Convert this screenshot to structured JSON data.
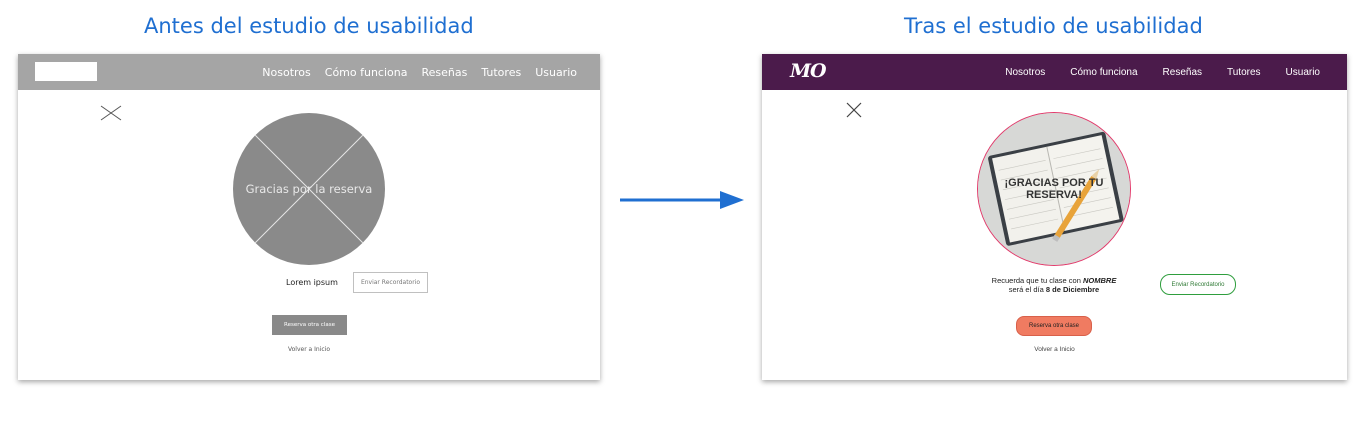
{
  "before": {
    "heading": "Antes del estudio de usabilidad",
    "nav": {
      "items": [
        "Nosotros",
        "Cómo funciona",
        "Reseñas",
        "Tutores",
        "Usuario"
      ]
    },
    "hero_text": "Gracias por la reserva",
    "lorem": "Lorem ipsum",
    "reminder_button": "Enviar Recordatorio",
    "book_button": "Reserva otra clase",
    "home_link": "Volver a Inicio"
  },
  "after": {
    "heading": "Tras el estudio de usabilidad",
    "logo": "MO",
    "nav": {
      "items": [
        "Nosotros",
        "Cómo funciona",
        "Reseñas",
        "Tutores",
        "Usuario"
      ]
    },
    "hero_text": "¡GRACIAS POR TU RESERVA!",
    "reminder_text_prefix": "Recuerda que tu clase con",
    "reminder_name": "NOMBRE",
    "reminder_text_mid": "será el día",
    "reminder_date": "8 de Diciembre",
    "reminder_button": "Enviar Recordatorio",
    "book_button": "Reserva otra clase",
    "home_link": "Volver a Inicio"
  },
  "colors": {
    "heading": "#1f6fd1",
    "arrow": "#1f6fd1",
    "before_nav": "#a5a5a5",
    "after_nav": "#4b1b4b",
    "after_circle_border": "#e23a6b",
    "after_reminder_border": "#2f9e3e",
    "after_book_button": "#f07b61"
  },
  "icons": {
    "close": "close-icon",
    "arrow": "right-arrow-icon"
  }
}
